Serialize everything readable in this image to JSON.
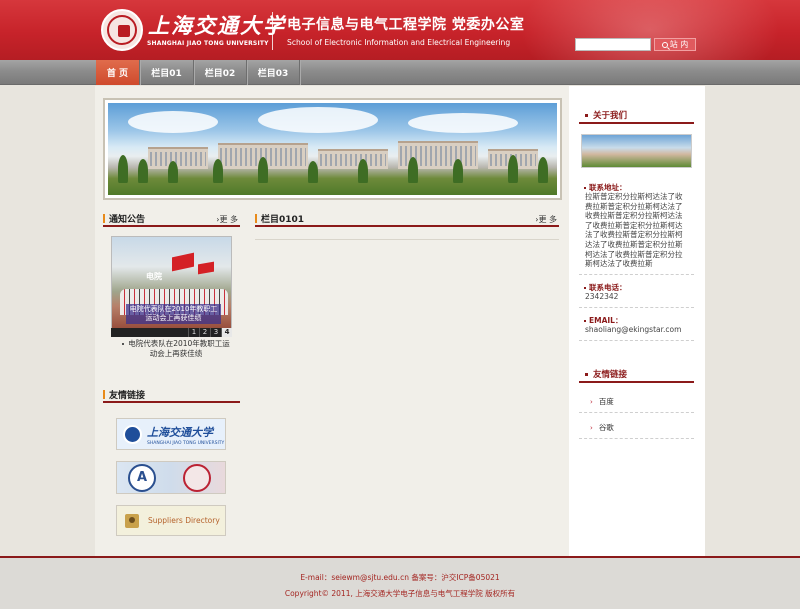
{
  "header": {
    "university_cn": "上海交通大学",
    "university_en": "SHANGHAI JIAO TONG UNIVERSITY",
    "school_cn": "电子信息与电气工程学院 党委办公室",
    "school_en": "School of Electronic Information and Electrical Engineering",
    "search": {
      "value": "",
      "button_label": "站 内"
    }
  },
  "nav": {
    "items": [
      {
        "label": "首 页",
        "active": true
      },
      {
        "label": "栏目01"
      },
      {
        "label": "栏目02"
      },
      {
        "label": "栏目03"
      }
    ]
  },
  "notice": {
    "title": "通知公告",
    "more": "更 多",
    "photo_label": "电院",
    "photo_caption": "电院代表队在2010年教职工运动会上再获佳绩",
    "pages": [
      "1",
      "2",
      "3",
      "4"
    ],
    "active_page": "4",
    "item_text": "电院代表队在2010年教职工运动会上再获佳绩"
  },
  "column": {
    "title": "栏目0101",
    "more": "更 多"
  },
  "friend_links_left": {
    "title": "友情链接",
    "logos": [
      {
        "cn": "上海交通大学",
        "en": "SHANGHAI JIAO TONG UNIVERSITY"
      },
      {
        "letter": "A"
      },
      {
        "label": "Suppliers Directory"
      }
    ]
  },
  "about": {
    "title": "关于我们",
    "address_label": "联系地址：",
    "address_value": "拉斯普定积分拉斯柯达法了收费拉斯普定积分拉斯柯达法了收费拉斯普定积分拉斯柯达法了收费拉斯普定积分拉斯柯达法了收费拉斯普定积分拉斯柯达法了收费拉斯普定积分拉斯柯达法了收费拉斯普定积分拉斯柯达法了收费拉斯",
    "phone_label": "联系电话：",
    "phone_value": "2342342",
    "email_label": "EMAIL：",
    "email_value": "shaoliang@ekingstar.com"
  },
  "friend_links_right": {
    "title": "友情链接",
    "items": [
      "百度",
      "谷歌"
    ]
  },
  "footer": {
    "line1": "E-mail：seiewm@sjtu.edu.cn 备案号：沪交ICP备05021",
    "line2": "Copyright© 2011, 上海交通大学电子信息与电气工程学院 版权所有"
  },
  "colors": {
    "brand_red": "#c7232a",
    "dark_red": "#8b1a1a",
    "accent_orange": "#e88a1a",
    "nav_gray": "#8c8c8c"
  }
}
